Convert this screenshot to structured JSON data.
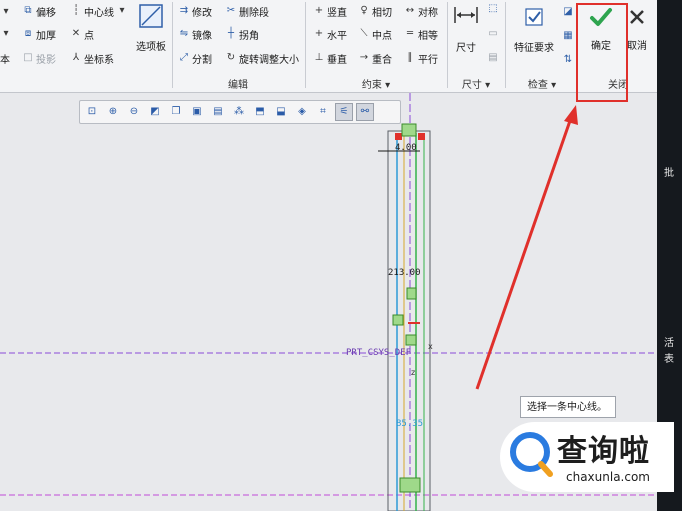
{
  "ribbon": {
    "edit_group": {
      "row1": [
        "偏移",
        "中心线"
      ],
      "row2": [
        "加厚",
        "点"
      ],
      "row3": [
        "投影",
        "坐标系"
      ],
      "options_panel": "选项板",
      "modify": "修改",
      "delete_segment": "删除段",
      "mirror": "镜像",
      "corner": "拐角",
      "divide": "分割",
      "rotate_resize": "旋转调整大小",
      "label": "编辑"
    },
    "constrain_group": {
      "items": [
        "竖直",
        "相切",
        "对称",
        "水平",
        "中点",
        "相等",
        "垂直",
        "重合",
        "平行"
      ],
      "label": "约束"
    },
    "dimension_group": {
      "button": "尺寸",
      "label": "尺寸"
    },
    "inspect_group": {
      "button": "特征要求",
      "label": "检查"
    },
    "close_group": {
      "ok": "确定",
      "cancel": "取消",
      "label": "关闭"
    },
    "left_cut": [
      "本"
    ]
  },
  "canvas": {
    "dim_top": "4.00",
    "dim_mid": "213.00",
    "dim_low": "85.35",
    "csys_label": "PRT_CSYS_DEF",
    "axis_x": "x",
    "axis_z": "z",
    "tooltip": "选择一条中心线。"
  },
  "watermark": {
    "text": "查询啦",
    "sub": "chaxunla.com"
  },
  "right_edge": [
    "批",
    "活",
    "表"
  ],
  "colors": {
    "accent_red": "#e0302b",
    "check_green": "#2ea44f",
    "ribbon_bg": "#f3f4f6"
  }
}
